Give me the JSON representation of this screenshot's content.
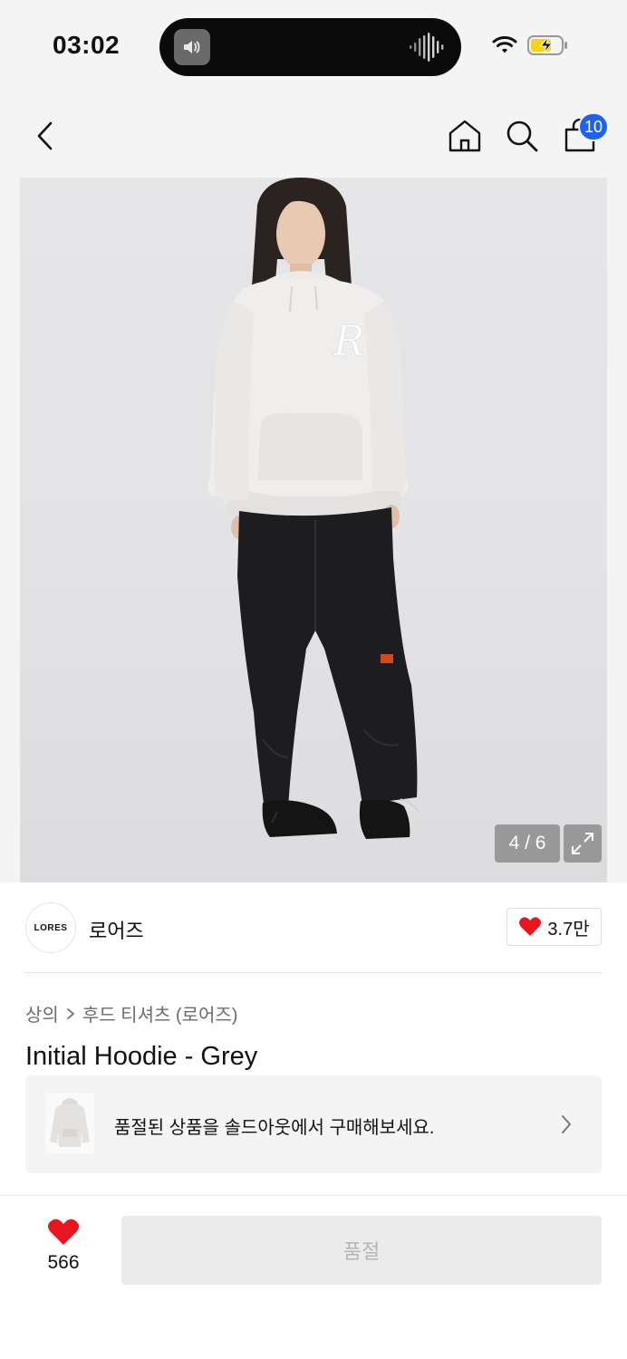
{
  "status_bar": {
    "time": "03:02"
  },
  "nav": {
    "bag_count": "10"
  },
  "gallery": {
    "counter": "4 / 6"
  },
  "brand": {
    "logo_text": "LORES",
    "name": "로어즈",
    "like_count": "3.7만"
  },
  "product": {
    "breadcrumb": [
      "상의",
      "후드 티셔츠 (로어즈)"
    ],
    "title": "Initial Hoodie - Grey"
  },
  "soldout_banner": {
    "text": "품절된 상품을 솔드아웃에서 구매해보세요."
  },
  "bottom_bar": {
    "wish_count": "566",
    "purchase_label": "품절"
  },
  "colors": {
    "accent_badge": "#1f62f0",
    "heart": "#e8141e",
    "battery_charge": "#f7d21c"
  }
}
